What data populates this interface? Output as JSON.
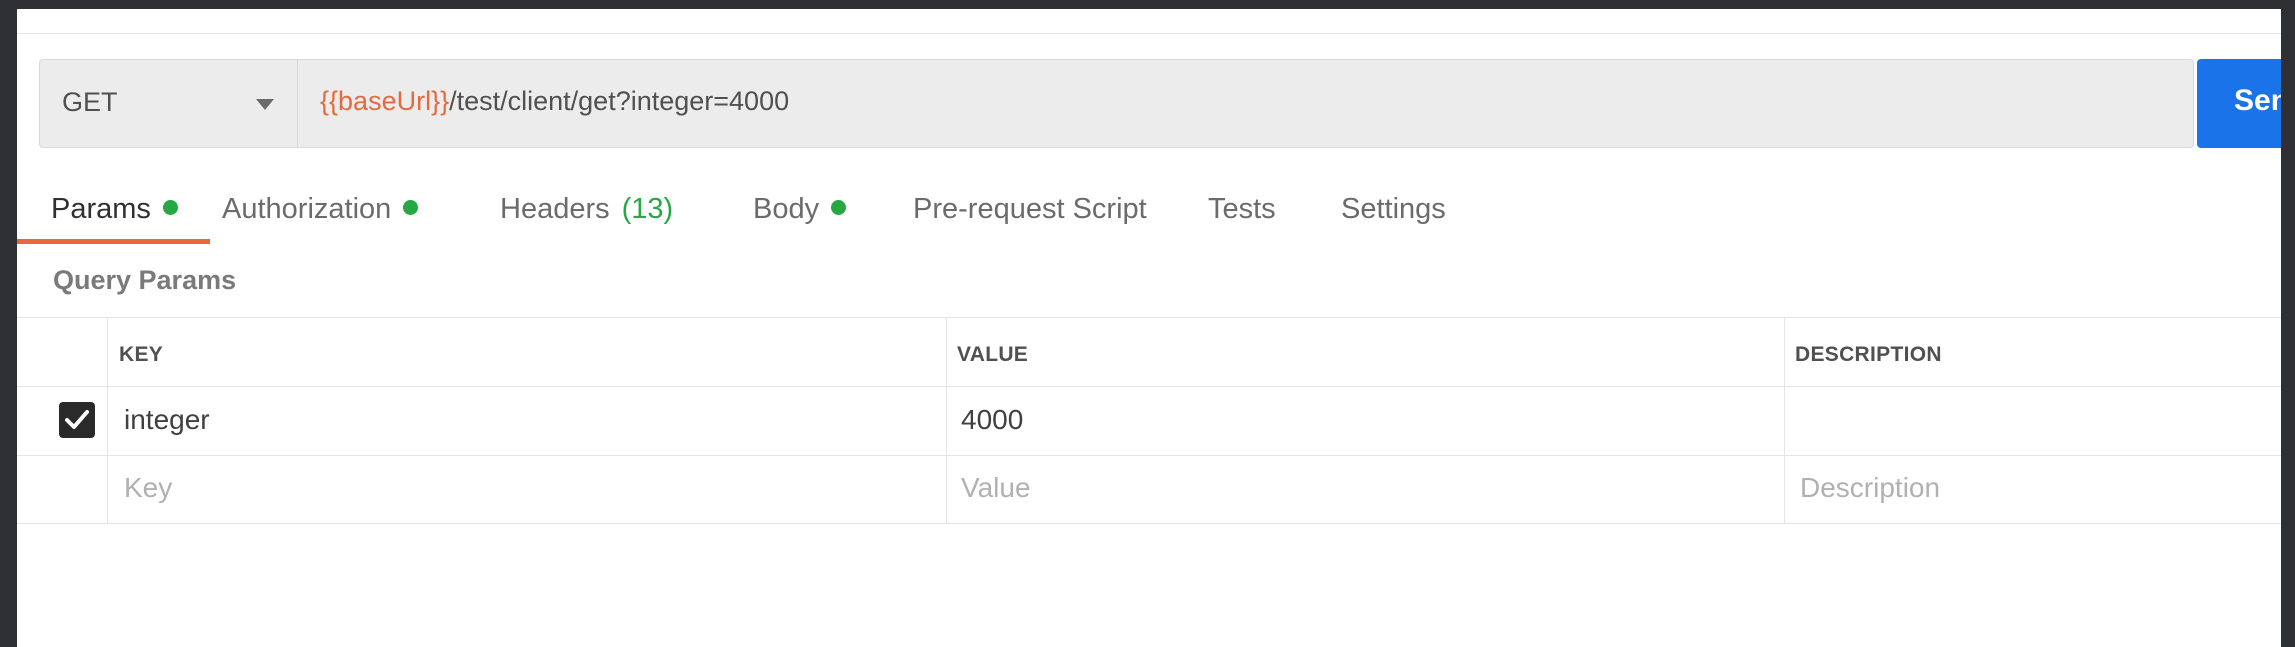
{
  "request": {
    "method": "GET",
    "url_variable": "{{baseUrl}}",
    "url_path": "/test/client/get?integer=4000",
    "send_label": "Send"
  },
  "tabs": {
    "params": "Params",
    "authorization": "Authorization",
    "headers": "Headers",
    "headers_count": "(13)",
    "body": "Body",
    "prerequest": "Pre-request Script",
    "tests": "Tests",
    "settings": "Settings"
  },
  "query_params": {
    "title": "Query Params",
    "columns": {
      "key": "KEY",
      "value": "VALUE",
      "description": "DESCRIPTION"
    },
    "rows": [
      {
        "checked": true,
        "key": "integer",
        "value": "4000",
        "description": ""
      }
    ],
    "placeholders": {
      "key": "Key",
      "value": "Value",
      "description": "Description"
    }
  },
  "colors": {
    "accent": "#e9683b",
    "indicator": "#27a844",
    "send": "#1a73e8",
    "variable": "#e56a3f"
  }
}
